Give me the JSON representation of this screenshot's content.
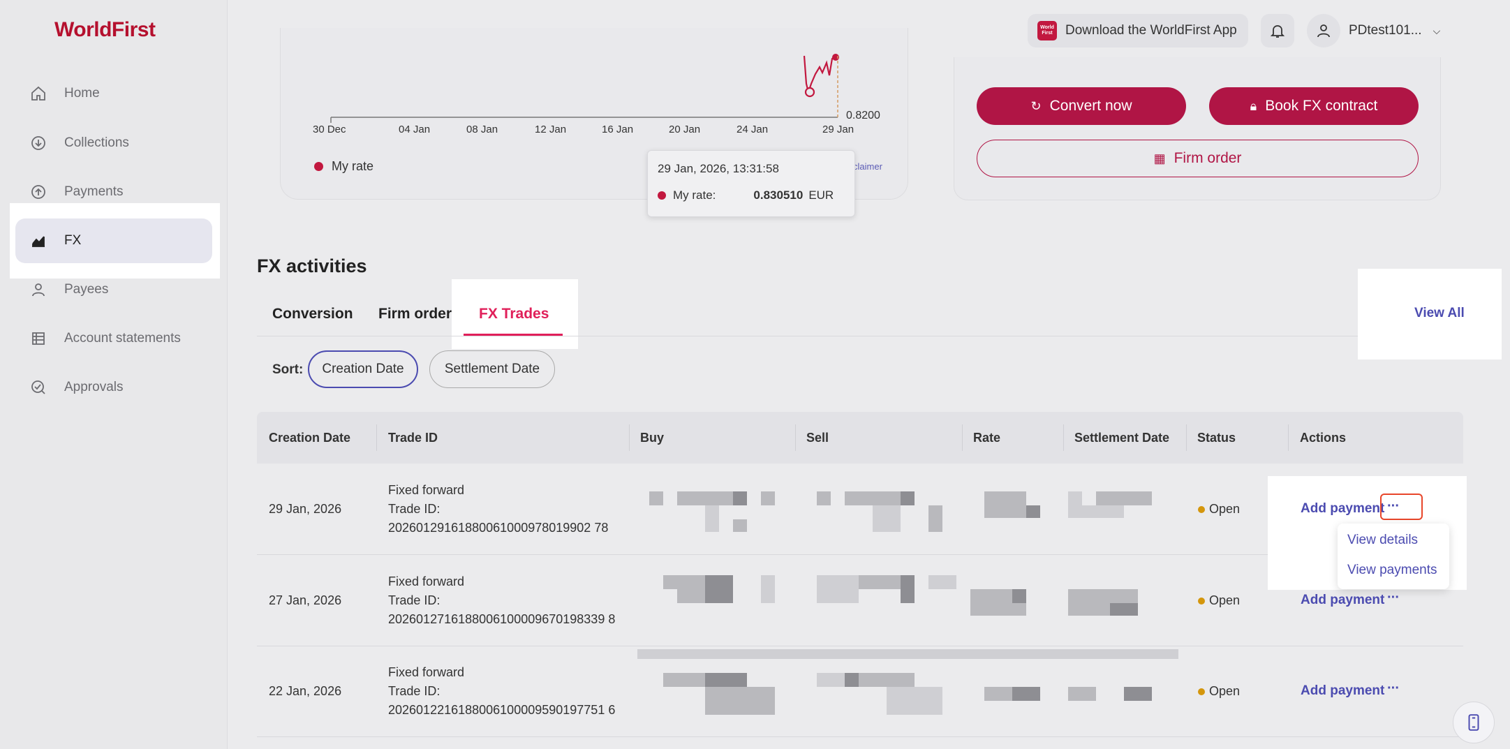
{
  "brand": {
    "logo": "WorldFirst",
    "accent": "#b01545",
    "link_color": "#4b4bb0"
  },
  "sidebar": {
    "items": [
      {
        "label": "Home",
        "icon": "home-icon"
      },
      {
        "label": "Collections",
        "icon": "collections-icon"
      },
      {
        "label": "Payments",
        "icon": "payments-icon"
      },
      {
        "label": "FX",
        "icon": "fx-chart-icon",
        "active": true
      },
      {
        "label": "Payees",
        "icon": "payees-icon"
      },
      {
        "label": "Account statements",
        "icon": "statements-icon"
      },
      {
        "label": "Approvals",
        "icon": "approvals-icon"
      }
    ]
  },
  "topbar": {
    "app_download": "Download the WorldFirst App",
    "app_logo_text": "World First",
    "username": "PDtest101..."
  },
  "rate_chart": {
    "x_ticks": [
      "30 Dec",
      "04 Jan",
      "08 Jan",
      "12 Jan",
      "16 Jan",
      "20 Jan",
      "24 Jan",
      "29 Jan"
    ],
    "y_tick": "0.8200",
    "legend": "My rate",
    "disclaimer": "claimer",
    "tooltip": {
      "datetime": "29 Jan, 2026, 13:31:58",
      "label": "My rate:",
      "value": "0.830510",
      "currency": "EUR"
    }
  },
  "actions": {
    "convert": "Convert now",
    "book": "Book FX contract",
    "firm": "Firm order"
  },
  "activities": {
    "title": "FX activities",
    "tabs": [
      "Conversion",
      "Firm order",
      "FX Trades"
    ],
    "view_all": "View All",
    "sort_label": "Sort:",
    "sort_options": [
      "Creation Date",
      "Settlement Date"
    ]
  },
  "table": {
    "columns": [
      "Creation Date",
      "Trade ID",
      "Buy",
      "Sell",
      "Rate",
      "Settlement Date",
      "Status",
      "Actions"
    ],
    "rows": [
      {
        "date": "29 Jan, 2026",
        "type": "Fixed forward",
        "id_label": "Trade ID:",
        "trade_id": "20260129161880061000978019902 78",
        "status": "Open",
        "action": "Add payment"
      },
      {
        "date": "27 Jan, 2026",
        "type": "Fixed forward",
        "id_label": "Trade ID:",
        "trade_id": "2026012716188006100009670198339 8",
        "status": "Open",
        "action": "Add payment"
      },
      {
        "date": "22 Jan, 2026",
        "type": "Fixed forward",
        "id_label": "Trade ID:",
        "trade_id": "2026012216188006100009590197751 6",
        "status": "Open",
        "action": "Add payment"
      }
    ],
    "more_label": "···",
    "menu": [
      "View details",
      "View payments"
    ]
  }
}
